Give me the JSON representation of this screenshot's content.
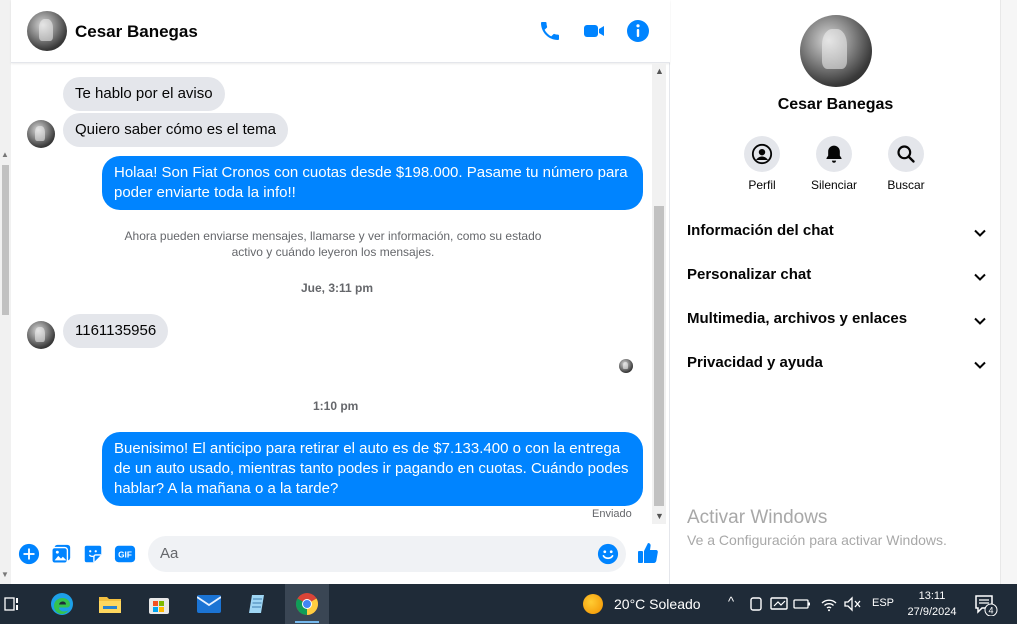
{
  "colors": {
    "accent": "#0084ff",
    "bubble_in": "#e4e6eb",
    "taskbar": "#1f2b38"
  },
  "header": {
    "contact_name": "Cesar Banegas",
    "icons": [
      "phone-icon",
      "video-camera-icon",
      "info-icon"
    ]
  },
  "messages": {
    "in_1": "Te hablo por el aviso",
    "in_2": "Quiero saber cómo es el tema",
    "out_1_line1": "Holaa! Son Fiat Cronos con cuotas desde $198.000. Pasame tu número para",
    "out_1_line2": "poder enviarte toda la info!!",
    "system_line1": "Ahora pueden enviarse mensajes, llamarse y ver información, como su estado",
    "system_line2": "activo y cuándo leyeron los mensajes.",
    "time_1": "Jue, 3:11 pm",
    "in_3": "1161135956",
    "time_2": "1:10 pm",
    "out_2_line1": "Buenisimo!  El anticipo para retirar el auto es de $7.133.400 o con la entrega",
    "out_2_line2": "de un auto usado, mientras tanto podes ir pagando en cuotas. Cuándo podes",
    "out_2_line3": "hablar? A la mañana o a la tarde?",
    "status": "Enviado"
  },
  "composer": {
    "placeholder": "Aa",
    "icons": [
      "add-icon",
      "image-icon",
      "sticker-icon",
      "gif-icon",
      "emoji-icon",
      "like-icon"
    ],
    "gif_label": "GIF"
  },
  "info_panel": {
    "name": "Cesar Banegas",
    "actions": [
      {
        "label": "Perfil",
        "icon": "profile-icon"
      },
      {
        "label": "Silenciar",
        "icon": "bell-icon"
      },
      {
        "label": "Buscar",
        "icon": "search-icon"
      }
    ],
    "sections": [
      "Información del chat",
      "Personalizar chat",
      "Multimedia, archivos y enlaces",
      "Privacidad y ayuda"
    ]
  },
  "watermark": {
    "title": "Activar Windows",
    "subtitle": "Ve a Configuración para activar Windows."
  },
  "taskbar": {
    "apps": [
      "task-view-icon",
      "edge-icon",
      "file-explorer-icon",
      "microsoft-store-icon",
      "mail-icon",
      "notepad-icon",
      "chrome-icon"
    ],
    "weather": "20°C  Soleado",
    "language": "ESP",
    "time": "13:11",
    "date": "27/9/2024",
    "notification_count": "4"
  }
}
